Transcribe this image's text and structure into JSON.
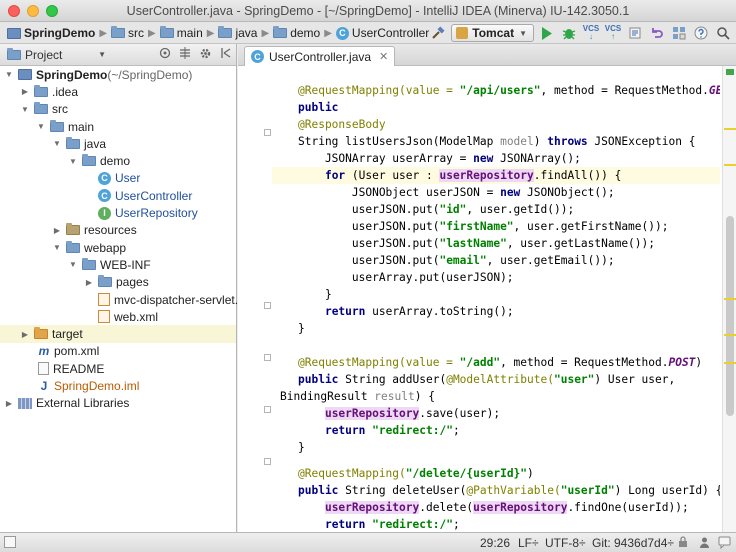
{
  "window": {
    "title": "UserController.java - SpringDemo - [~/SpringDemo] - IntelliJ IDEA (Minerva) IU-142.3050.1"
  },
  "breadcrumbs": [
    "SpringDemo",
    "src",
    "main",
    "java",
    "demo",
    "UserController"
  ],
  "toolbar": {
    "run_config": "Tomcat",
    "vcs_label": "VCS"
  },
  "project_panel": {
    "view_label": "Project"
  },
  "tree": [
    {
      "label": "SpringDemo",
      "suffix": " (~/SpringDemo)"
    },
    {
      "label": ".idea"
    },
    {
      "label": "src"
    },
    {
      "label": "main"
    },
    {
      "label": "java"
    },
    {
      "label": "demo"
    },
    {
      "label": "User"
    },
    {
      "label": "UserController"
    },
    {
      "label": "UserRepository"
    },
    {
      "label": "resources"
    },
    {
      "label": "webapp"
    },
    {
      "label": "WEB-INF"
    },
    {
      "label": "pages"
    },
    {
      "label": "mvc-dispatcher-servlet.xml"
    },
    {
      "label": "web.xml"
    },
    {
      "label": "target"
    },
    {
      "label": "pom.xml"
    },
    {
      "label": "README"
    },
    {
      "label": "SpringDemo.iml"
    },
    {
      "label": "External Libraries"
    }
  ],
  "editor": {
    "tab_label": "UserController.java",
    "code": {
      "l0": [
        "@RequestMapping(value = ",
        "\"/api/users\"",
        ", method = RequestMethod.",
        "GET",
        ")"
      ],
      "l1": [
        "public"
      ],
      "l2": [
        "@ResponseBody"
      ],
      "l3": [
        "String listUsersJson(ModelMap ",
        "model",
        ") ",
        "throws",
        " JSONException {"
      ],
      "l4": [
        "    JSONArray userArray = ",
        "new",
        " JSONArray();"
      ],
      "l5": [
        "    ",
        "for",
        " (User user : ",
        "userRepository",
        ".findAll()) {"
      ],
      "l6": [
        "        JSONObject userJSON = ",
        "new",
        " JSONObject();"
      ],
      "l7": [
        "        userJSON.put(",
        "\"id\"",
        ", user.getId());"
      ],
      "l8": [
        "        userJSON.put(",
        "\"firstName\"",
        ", user.getFirstName());"
      ],
      "l9": [
        "        userJSON.put(",
        "\"lastName\"",
        ", user.getLastName());"
      ],
      "l10": [
        "        userJSON.put(",
        "\"email\"",
        ", user.getEmail());"
      ],
      "l11": [
        "        userArray.put(userJSON);"
      ],
      "l12": [
        "    }"
      ],
      "l13": [
        "    ",
        "return",
        " userArray.toString();"
      ],
      "l14": [
        "}"
      ],
      "l15": [
        ""
      ],
      "l16": [
        "@RequestMapping(value = ",
        "\"/add\"",
        ", method = RequestMethod.",
        "POST",
        ")"
      ],
      "l17": [
        "public",
        " String addUser(",
        "@ModelAttribute(",
        "\"user\"",
        ") User user,"
      ],
      "l18": [
        "BindingResult ",
        "result",
        ") {"
      ],
      "l19": [
        "    ",
        "userRepository",
        ".save(user);"
      ],
      "l20": [
        "    ",
        "return",
        " ",
        "\"redirect:/\"",
        ";"
      ],
      "l21": [
        "}"
      ],
      "l22": [
        ""
      ],
      "l23": [
        "@RequestMapping(",
        "\"/delete/{userId}\"",
        ")"
      ],
      "l24": [
        "public",
        " String deleteUser(",
        "@PathVariable(",
        "\"userId\"",
        ") Long userId) {"
      ],
      "l25": [
        "    ",
        "userRepository",
        ".delete(",
        "userRepository",
        ".findOne(userId));"
      ],
      "l26": [
        "    ",
        "return",
        " ",
        "\"redirect:/\"",
        ";"
      ],
      "l27": [
        "}"
      ],
      "l28": [
        "}"
      ]
    }
  },
  "status_bar": {
    "position": "29:26",
    "line_sep": "LF÷",
    "encoding": "UTF-8÷",
    "git": "Git: 9436d7d4÷"
  }
}
